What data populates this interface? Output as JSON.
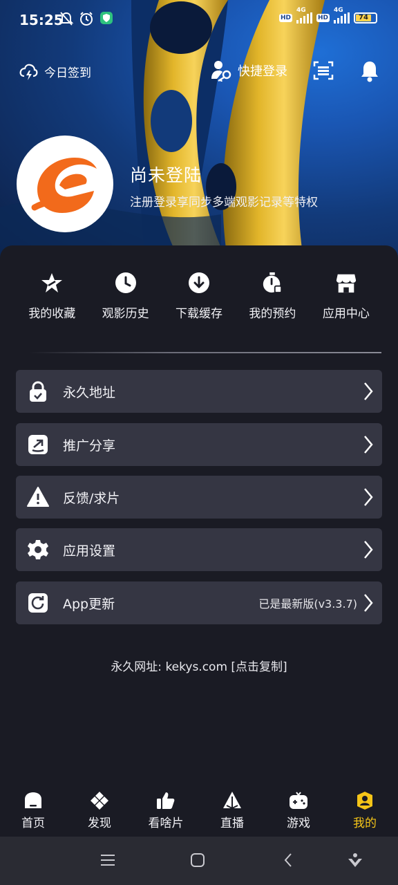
{
  "status": {
    "time": "15:25",
    "net1": "HD",
    "gen1": "4G",
    "net2": "HD",
    "gen2": "4G",
    "battery": "74"
  },
  "topbar": {
    "checkin_label": "今日签到",
    "quick_login_label": "快捷登录"
  },
  "profile": {
    "name": "尚未登陆",
    "subtitle": "注册登录享同步多端观影记录等特权"
  },
  "quick_actions": [
    {
      "label": "我的收藏",
      "icon": "star-icon"
    },
    {
      "label": "观影历史",
      "icon": "clock-icon"
    },
    {
      "label": "下载缓存",
      "icon": "download-icon"
    },
    {
      "label": "我的预约",
      "icon": "stopwatch-icon"
    },
    {
      "label": "应用中心",
      "icon": "store-icon"
    }
  ],
  "menu": [
    {
      "label": "永久地址",
      "icon": "lock-icon",
      "value": ""
    },
    {
      "label": "推广分享",
      "icon": "share-icon",
      "value": ""
    },
    {
      "label": "反馈/求片",
      "icon": "warning-icon",
      "value": ""
    },
    {
      "label": "应用设置",
      "icon": "gear-icon",
      "value": ""
    },
    {
      "label": "App更新",
      "icon": "refresh-icon",
      "value": "已是最新版(v3.3.7)"
    }
  ],
  "footer_link": "永久网址: kekys.com [点击复制]",
  "tabs": [
    {
      "label": "首页",
      "icon": "home-icon",
      "active": false
    },
    {
      "label": "发现",
      "icon": "discover-icon",
      "active": false
    },
    {
      "label": "看啥片",
      "icon": "thumbs-up-icon",
      "active": false
    },
    {
      "label": "直播",
      "icon": "live-icon",
      "active": false
    },
    {
      "label": "游戏",
      "icon": "gamepad-icon",
      "active": false
    },
    {
      "label": "我的",
      "icon": "user-icon",
      "active": true
    }
  ],
  "colors": {
    "accent": "#f5c518",
    "panel": "#1a1b24",
    "menu_row": "#353643",
    "logo_orange": "#f26a1b"
  }
}
